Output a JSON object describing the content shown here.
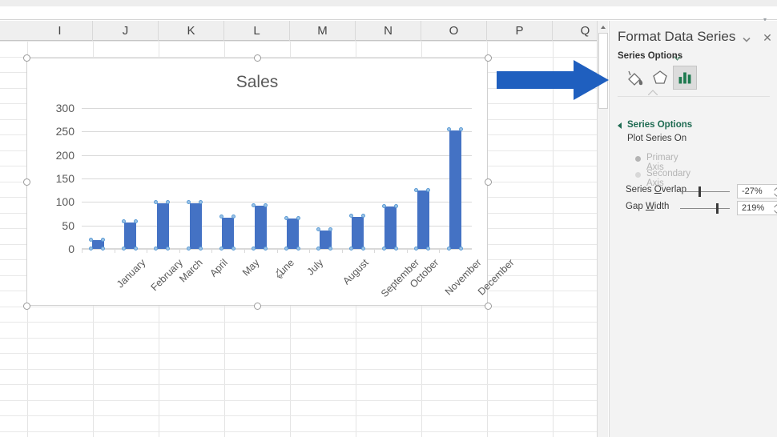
{
  "spreadsheet": {
    "columns": [
      "I",
      "J",
      "K",
      "L",
      "M",
      "N",
      "O",
      "P",
      "Q"
    ],
    "scroll_up_icon": "scroll-up-arrow-icon"
  },
  "annotation": {
    "arrow_icon": "blue-right-arrow-annotation",
    "color": "#1f5fbf"
  },
  "chart_data": {
    "type": "bar",
    "title": "Sales",
    "xlabel": "",
    "ylabel": "",
    "categories": [
      "January",
      "February",
      "March",
      "April",
      "May",
      "June",
      "July",
      "August",
      "September",
      "October",
      "November",
      "December"
    ],
    "values": [
      18,
      57,
      98,
      98,
      67,
      92,
      64,
      40,
      69,
      90,
      124,
      253
    ],
    "ylim": [
      0,
      300
    ],
    "yticks": [
      0,
      50,
      100,
      150,
      200,
      250,
      300
    ],
    "ytick_labels": [
      "0",
      "50",
      "100",
      "150",
      "200",
      "250",
      "300"
    ],
    "grid": true,
    "legend": "none",
    "series_color": "#4472c4",
    "selected": true
  },
  "pane": {
    "title": "Format Data Series",
    "caret_icon": "chevron-down-icon",
    "close_icon": "close-icon",
    "series_options_label": "Series Options",
    "series_options_caret_icon": "chevron-down-icon",
    "tabs": [
      {
        "name": "fill-line-tab",
        "icon": "paint-bucket-icon",
        "selected": false
      },
      {
        "name": "effects-tab",
        "icon": "pentagon-effects-icon",
        "selected": false
      },
      {
        "name": "series-options-tab",
        "icon": "bar-chart-icon",
        "selected": true
      }
    ],
    "section": {
      "heading": "Series Options",
      "expanded": true,
      "plot_series_on_label": "Plot Series On",
      "radios": [
        {
          "label": "Primary Axis",
          "checked": true
        },
        {
          "label": "Secondary Axis",
          "checked": false
        }
      ],
      "controls": [
        {
          "label_before": "Series ",
          "label_accel": "O",
          "label_after": "verlap",
          "value": "-27%",
          "slider_pct": 37
        },
        {
          "label_before": "Gap ",
          "label_accel": "W",
          "label_after": "idth",
          "value": "219%",
          "slider_pct": 73
        }
      ]
    }
  }
}
